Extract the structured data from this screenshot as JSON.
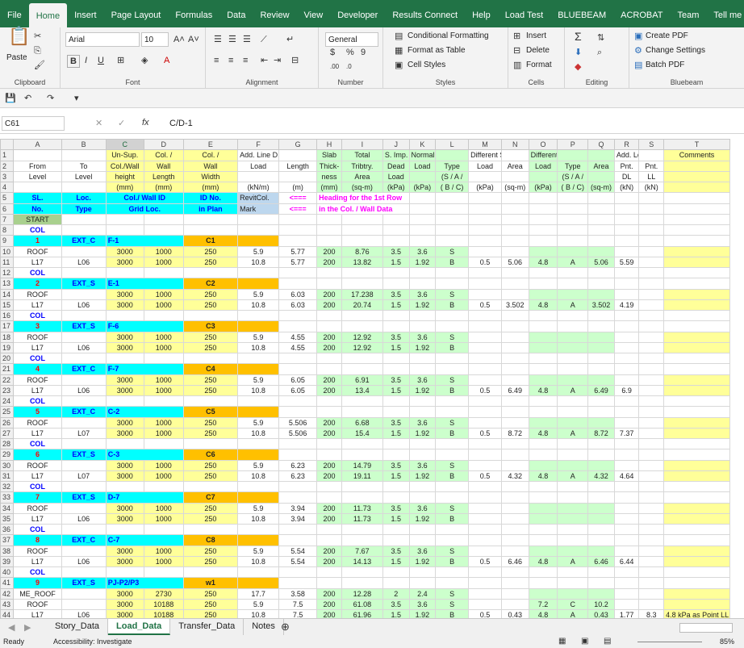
{
  "tabs": [
    "File",
    "Home",
    "Insert",
    "Page Layout",
    "Formulas",
    "Data",
    "Review",
    "View",
    "Developer",
    "Results Connect",
    "Help",
    "Load Test",
    "BLUEBEAM",
    "ACROBAT",
    "Team",
    "Tell me"
  ],
  "ribbon": {
    "paste": "Paste",
    "clipboard": "Clipboard",
    "font_name": "Arial",
    "font_size": "10",
    "font": "Font",
    "alignment": "Alignment",
    "number_format": "General",
    "number": "Number",
    "cond_fmt": "Conditional Formatting",
    "fmt_table": "Format as Table",
    "cell_styles": "Cell Styles",
    "styles": "Styles",
    "insert": "Insert",
    "delete": "Delete",
    "format": "Format",
    "cells": "Cells",
    "editing": "Editing",
    "create_pdf": "Create PDF",
    "change_settings": "Change Settings",
    "batch_pdf": "Batch PDF",
    "bluebeam": "Bluebeam"
  },
  "name_box": "C61",
  "formula": "C/D-1",
  "sheet_tabs": [
    "Story_Data",
    "Load_Data",
    "Transfer_Data",
    "Notes"
  ],
  "status": {
    "ready": "Ready",
    "accessibility": "Accessibility: Investigate",
    "zoom": "85%"
  },
  "cols": [
    "A",
    "B",
    "C",
    "D",
    "E",
    "F",
    "G",
    "H",
    "I",
    "J",
    "K",
    "L",
    "M",
    "N",
    "O",
    "P",
    "Q",
    "R",
    "S",
    "T"
  ],
  "header": {
    "r1": [
      "",
      "",
      "Un-Sup.",
      "Col. /",
      "Col. /",
      "Add. Line D. Ld",
      "",
      "Slab",
      "Total",
      "S. Imp.",
      "Normal  LL",
      "",
      "Different SIDL",
      "",
      "Different LL",
      "",
      "",
      "Add. Load",
      "",
      "Comments"
    ],
    "r2": [
      "From",
      "To",
      "Col./Wall",
      "Wall",
      "Wall",
      "Load",
      "Length",
      "Thick-",
      "Tribtry.",
      "Dead",
      "Load",
      "Type",
      "Load",
      "Area",
      "Load",
      "Type",
      "Area",
      "Pnt.",
      "Pnt.",
      ""
    ],
    "r3": [
      "Level",
      "Level",
      "height",
      "Length",
      "Width",
      "",
      "",
      "ness",
      "Area",
      "Load",
      "",
      "(S / A /",
      "",
      "",
      "",
      "(S / A /",
      "",
      "DL",
      "LL",
      ""
    ],
    "r4": [
      "",
      "",
      "(mm)",
      "(mm)",
      "(mm)",
      "(kN/m)",
      "(m)",
      "(mm)",
      "(sq-m)",
      "(kPa)",
      "(kPa)",
      "( B / C)",
      "(kPa)",
      "(sq-m)",
      "(kPa)",
      "( B / C)",
      "(sq-m)",
      "(kN)",
      "(kN)",
      ""
    ],
    "r5": [
      "SL.",
      "Loc.",
      "Col./ Wall ID",
      "",
      "ID No.",
      "RevitCol.",
      "<===",
      "Heading for the 1st Row"
    ],
    "r6": [
      "No.",
      "Type",
      "Grid Loc.",
      "",
      "in Plan",
      "Mark",
      "<===",
      "in the Col. / Wall Data"
    ],
    "start": "START"
  },
  "groups": [
    {
      "rows": [
        8,
        9,
        10,
        11
      ],
      "sl": "1",
      "loc": "EXT_C",
      "grid": "F-1",
      "id": "C1",
      "lines": [
        [
          "ROOF",
          "",
          "3000",
          "1000",
          "250",
          "5.9",
          "5.77",
          "200",
          "8.76",
          "3.5",
          "3.6",
          "S",
          "",
          "",
          "",
          "",
          "",
          "",
          "",
          ""
        ],
        [
          "L17",
          "L06",
          "3000",
          "1000",
          "250",
          "10.8",
          "5.77",
          "200",
          "13.82",
          "1.5",
          "1.92",
          "B",
          "0.5",
          "5.06",
          "4.8",
          "A",
          "5.06",
          "5.59",
          "",
          ""
        ]
      ]
    },
    {
      "rows": [
        12,
        13,
        14,
        15
      ],
      "sl": "2",
      "loc": "EXT_S",
      "grid": "E-1",
      "id": "C2",
      "lines": [
        [
          "ROOF",
          "",
          "3000",
          "1000",
          "250",
          "5.9",
          "6.03",
          "200",
          "17.238",
          "3.5",
          "3.6",
          "S",
          "",
          "",
          "",
          "",
          "",
          "",
          "",
          ""
        ],
        [
          "L17",
          "L06",
          "3000",
          "1000",
          "250",
          "10.8",
          "6.03",
          "200",
          "20.74",
          "1.5",
          "1.92",
          "B",
          "0.5",
          "3.502",
          "4.8",
          "A",
          "3.502",
          "4.19",
          "",
          ""
        ]
      ]
    },
    {
      "rows": [
        16,
        17,
        18,
        19
      ],
      "sl": "3",
      "loc": "EXT_S",
      "grid": "F-6",
      "id": "C3",
      "lines": [
        [
          "ROOF",
          "",
          "3000",
          "1000",
          "250",
          "5.9",
          "4.55",
          "200",
          "12.92",
          "3.5",
          "3.6",
          "S",
          "",
          "",
          "",
          "",
          "",
          "",
          "",
          ""
        ],
        [
          "L17",
          "L06",
          "3000",
          "1000",
          "250",
          "10.8",
          "4.55",
          "200",
          "12.92",
          "1.5",
          "1.92",
          "B",
          "",
          "",
          "",
          "",
          "",
          "",
          "",
          ""
        ]
      ]
    },
    {
      "rows": [
        20,
        21,
        22,
        23
      ],
      "sl": "4",
      "loc": "EXT_C",
      "grid": "F-7",
      "id": "C4",
      "lines": [
        [
          "ROOF",
          "",
          "3000",
          "1000",
          "250",
          "5.9",
          "6.05",
          "200",
          "6.91",
          "3.5",
          "3.6",
          "S",
          "",
          "",
          "",
          "",
          "",
          "",
          "",
          ""
        ],
        [
          "L17",
          "L06",
          "3000",
          "1000",
          "250",
          "10.8",
          "6.05",
          "200",
          "13.4",
          "1.5",
          "1.92",
          "B",
          "0.5",
          "6.49",
          "4.8",
          "A",
          "6.49",
          "6.9",
          "",
          ""
        ]
      ]
    },
    {
      "rows": [
        24,
        25,
        26,
        27
      ],
      "sl": "5",
      "loc": "EXT_C",
      "grid": "C-2",
      "id": "C5",
      "lines": [
        [
          "ROOF",
          "",
          "3000",
          "1000",
          "250",
          "5.9",
          "5.506",
          "200",
          "6.68",
          "3.5",
          "3.6",
          "S",
          "",
          "",
          "",
          "",
          "",
          "",
          "",
          ""
        ],
        [
          "L17",
          "L07",
          "3000",
          "1000",
          "250",
          "10.8",
          "5.506",
          "200",
          "15.4",
          "1.5",
          "1.92",
          "B",
          "0.5",
          "8.72",
          "4.8",
          "A",
          "8.72",
          "7.37",
          "",
          ""
        ]
      ]
    },
    {
      "rows": [
        28,
        29,
        30,
        31
      ],
      "sl": "6",
      "loc": "EXT_S",
      "grid": "C-3",
      "id": "C6",
      "lines": [
        [
          "ROOF",
          "",
          "3000",
          "1000",
          "250",
          "5.9",
          "6.23",
          "200",
          "14.79",
          "3.5",
          "3.6",
          "S",
          "",
          "",
          "",
          "",
          "",
          "",
          "",
          ""
        ],
        [
          "L17",
          "L07",
          "3000",
          "1000",
          "250",
          "10.8",
          "6.23",
          "200",
          "19.11",
          "1.5",
          "1.92",
          "B",
          "0.5",
          "4.32",
          "4.8",
          "A",
          "4.32",
          "4.64",
          "",
          ""
        ]
      ]
    },
    {
      "rows": [
        32,
        33,
        34,
        35
      ],
      "sl": "7",
      "loc": "EXT_S",
      "grid": "D-7",
      "id": "C7",
      "lines": [
        [
          "ROOF",
          "",
          "3000",
          "1000",
          "250",
          "5.9",
          "3.94",
          "200",
          "11.73",
          "3.5",
          "3.6",
          "S",
          "",
          "",
          "",
          "",
          "",
          "",
          "",
          ""
        ],
        [
          "L17",
          "L06",
          "3000",
          "1000",
          "250",
          "10.8",
          "3.94",
          "200",
          "11.73",
          "1.5",
          "1.92",
          "B",
          "",
          "",
          "",
          "",
          "",
          "",
          "",
          ""
        ]
      ]
    },
    {
      "rows": [
        36,
        37,
        38,
        39
      ],
      "sl": "8",
      "loc": "EXT_C",
      "grid": "C-7",
      "id": "C8",
      "lines": [
        [
          "ROOF",
          "",
          "3000",
          "1000",
          "250",
          "5.9",
          "5.54",
          "200",
          "7.67",
          "3.5",
          "3.6",
          "S",
          "",
          "",
          "",
          "",
          "",
          "",
          "",
          ""
        ],
        [
          "L17",
          "L06",
          "3000",
          "1000",
          "250",
          "10.8",
          "5.54",
          "200",
          "14.13",
          "1.5",
          "1.92",
          "B",
          "0.5",
          "6.46",
          "4.8",
          "A",
          "6.46",
          "6.44",
          "",
          ""
        ]
      ]
    },
    {
      "rows": [
        40,
        41,
        42,
        43,
        44
      ],
      "sl": "9",
      "loc": "EXT_S",
      "grid": "PJ-P2/P3",
      "id": "w1",
      "lines": [
        [
          "ME_ROOF",
          "",
          "3000",
          "2730",
          "250",
          "17.7",
          "3.58",
          "200",
          "12.28",
          "2",
          "2.4",
          "S",
          "",
          "",
          "",
          "",
          "",
          "",
          "",
          ""
        ],
        [
          "ROOF",
          "",
          "3000",
          "10188",
          "250",
          "5.9",
          "7.5",
          "200",
          "61.08",
          "3.5",
          "3.6",
          "S",
          "",
          "",
          "7.2",
          "C",
          "10.2",
          "",
          "",
          ""
        ],
        [
          "L17",
          "L06",
          "3000",
          "10188",
          "250",
          "10.8",
          "7.5",
          "200",
          "61.96",
          "1.5",
          "1.92",
          "B",
          "0.5",
          "0.43",
          "4.8",
          "A",
          "0.43",
          "1.77",
          "8.3",
          "4.8 kPa as Point LL"
        ]
      ]
    }
  ],
  "col_label": "COL"
}
